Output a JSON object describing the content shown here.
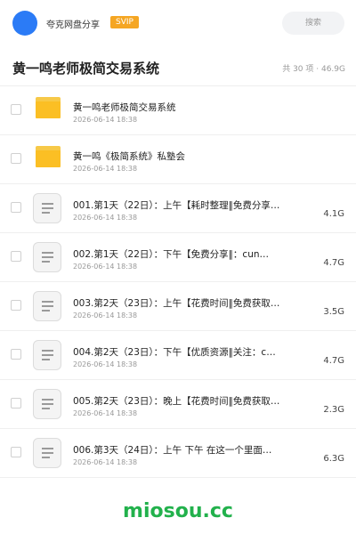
{
  "header": {
    "user_name": "夸克网盘分享",
    "vip_label": "SVIP",
    "search_label": "搜索",
    "accent_color": "#2b7bf6",
    "vip_color": "#f5a623"
  },
  "folder": {
    "title": "黄一鸣老师极简交易系统",
    "summary": "共 30 项 · 46.9G"
  },
  "items": [
    {
      "type": "folder",
      "name": "黄一鸣老师极简交易系统",
      "date": "2026-06-14 18:38",
      "size": ""
    },
    {
      "type": "folder",
      "name": "黄一鸣《极简系统》私塾会",
      "date": "2026-06-14 18:38",
      "size": ""
    },
    {
      "type": "file",
      "name": "001.第1天（22日）：上午【耗时整理‖免费分享…",
      "date": "2026-06-14 18:38",
      "size": "4.1G"
    },
    {
      "type": "file",
      "name": "002.第1天（22日）：下午【免费分享‖：cun…",
      "date": "2026-06-14 18:38",
      "size": "4.7G"
    },
    {
      "type": "file",
      "name": "003.第2天（23日）：上午【花费时间‖免费获取…",
      "date": "2026-06-14 18:38",
      "size": "3.5G"
    },
    {
      "type": "file",
      "name": "004.第2天（23日）：下午【优质资源‖关注：c…",
      "date": "2026-06-14 18:38",
      "size": "4.7G"
    },
    {
      "type": "file",
      "name": "005.第2天（23日）：晚上【花费时间‖免费获取…",
      "date": "2026-06-14 18:38",
      "size": "2.3G"
    },
    {
      "type": "file",
      "name": "006.第3天（24日）：上午 下午 在这一个里面…",
      "date": "2026-06-14 18:38",
      "size": "6.3G"
    }
  ],
  "icons": {
    "folder": "folder-icon",
    "file": "document-icon"
  },
  "watermark": "miosou.cc"
}
